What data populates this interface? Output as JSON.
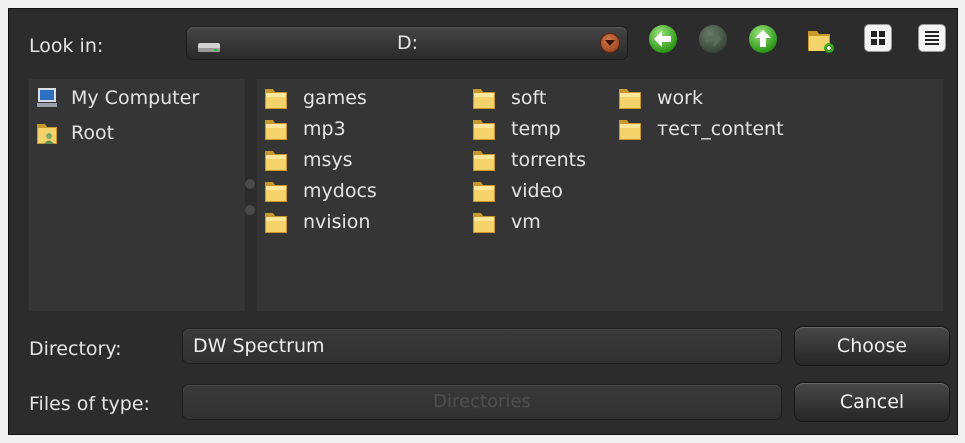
{
  "look_in": {
    "label": "Look in:",
    "value": "D:",
    "drive_icon": "drive-icon",
    "dropdown_icon": "chevron-down-icon"
  },
  "toolbar": {
    "back_icon": "arrow-left-icon",
    "forward_icon": "arrow-right-icon",
    "up_icon": "arrow-up-icon",
    "new_folder_icon": "new-folder-icon",
    "list_view_icon": "grid-view-icon",
    "detail_view_icon": "detail-view-icon"
  },
  "sidebar": {
    "items": [
      {
        "label": "My Computer",
        "icon": "computer-icon"
      },
      {
        "label": "Root",
        "icon": "folder-user-icon"
      }
    ]
  },
  "files": {
    "items": [
      {
        "name": "games"
      },
      {
        "name": "mp3"
      },
      {
        "name": "msys"
      },
      {
        "name": "mydocs"
      },
      {
        "name": "nvision"
      },
      {
        "name": "soft"
      },
      {
        "name": "temp"
      },
      {
        "name": "torrents"
      },
      {
        "name": "video"
      },
      {
        "name": "vm"
      },
      {
        "name": "work"
      },
      {
        "name": "тест_content"
      }
    ]
  },
  "directory": {
    "label": "Directory:",
    "value": "DW Spectrum"
  },
  "filter": {
    "label": "Files of type:",
    "value": "Directories"
  },
  "buttons": {
    "choose": "Choose",
    "cancel": "Cancel"
  },
  "colors": {
    "background": "#2c2c2c",
    "panel": "#353535",
    "text": "#e4e4e4",
    "folder": "#f0c848",
    "nav_green": "#3aa620"
  }
}
